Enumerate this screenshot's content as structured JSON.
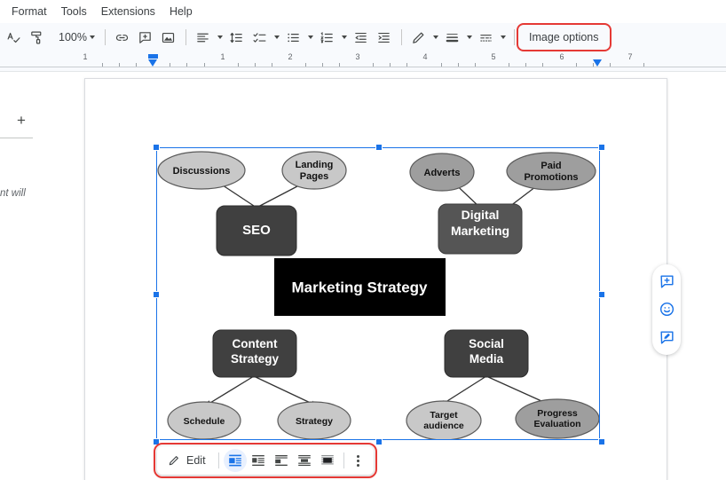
{
  "menubar": {
    "items": [
      {
        "label": "Format",
        "name": "menu-format"
      },
      {
        "label": "Tools",
        "name": "menu-tools"
      },
      {
        "label": "Extensions",
        "name": "menu-extensions"
      },
      {
        "label": "Help",
        "name": "menu-help"
      }
    ]
  },
  "toolbar": {
    "spelling_icon": "spellcheck-icon",
    "paint_format_icon": "paint-format-icon",
    "zoom_value": "100%",
    "link_icon": "insert-link-icon",
    "comment_icon": "add-comment-icon",
    "image_icon": "insert-image-icon",
    "align_icon": "text-align-left-icon",
    "line_spacing_icon": "line-spacing-icon",
    "checklist_icon": "checklist-icon",
    "bulleted_list_icon": "bulleted-list-icon",
    "numbered_list_icon": "numbered-list-icon",
    "decrease_indent_icon": "decrease-indent-icon",
    "increase_indent_icon": "increase-indent-icon",
    "pen_icon": "border-pen-icon",
    "border_weight_icon": "border-weight-icon",
    "border_dash_icon": "border-dash-icon",
    "image_options_label": "Image options",
    "image_options_highlight_color": "#e53935"
  },
  "ruler": {
    "numbers": [
      "1",
      "1",
      "2",
      "3",
      "4",
      "5",
      "6",
      "7"
    ],
    "left_indent_marker": "left-indent-marker",
    "right_indent_marker": "right-indent-marker"
  },
  "gutter": {
    "add_icon": "+",
    "partial_text": "nt will"
  },
  "diagram": {
    "title": "Marketing Strategy",
    "accent_node_bg": "#000000",
    "box_node_bg": "#404040",
    "ellipse_node_bg": "#c8c8c8",
    "edge_color": "#333333",
    "center": {
      "label": "Marketing Strategy"
    },
    "branches": [
      {
        "label": "SEO",
        "children": [
          "Discussions",
          "Landing Pages"
        ]
      },
      {
        "label": "Digital Marketing",
        "children": [
          "Adverts",
          "Paid Promotions"
        ]
      },
      {
        "label": "Content Strategy",
        "children": [
          "Schedule",
          "Strategy"
        ]
      },
      {
        "label": "Social Media",
        "children": [
          "Target audience",
          "Progress Evaluation"
        ]
      }
    ],
    "nodes": {
      "discussions": "Discussions",
      "landing_pages_line1": "Landing",
      "landing_pages_line2": "Pages",
      "seo": "SEO",
      "adverts": "Adverts",
      "paid_line1": "Paid",
      "paid_line2": "Promotions",
      "digital_line1": "Digital",
      "digital_line2": "Marketing",
      "content_line1": "Content",
      "content_line2": "Strategy",
      "social_line1": "Social",
      "social_line2": "Media",
      "schedule": "Schedule",
      "strategy": "Strategy",
      "target_line1": "Target",
      "target_line2": "audience",
      "progress_line1": "Progress",
      "progress_line2": "Evaluation"
    }
  },
  "selection": {
    "accent_color": "#1a73e8",
    "handles": [
      "nw",
      "n",
      "ne",
      "w",
      "e",
      "sw",
      "s",
      "se"
    ]
  },
  "image_bubble": {
    "edit_label": "Edit",
    "edit_icon": "pencil-icon",
    "highlight_color": "#e53935",
    "wrap_options": [
      {
        "name": "wrap-inline-icon",
        "active": true
      },
      {
        "name": "wrap-text-icon",
        "active": false
      },
      {
        "name": "wrap-break-text-icon",
        "active": false
      },
      {
        "name": "wrap-behind-text-icon",
        "active": false
      },
      {
        "name": "wrap-in-front-of-text-icon",
        "active": false
      }
    ],
    "more_icon": "more-options-icon"
  },
  "side_actions": {
    "items": [
      {
        "name": "add-comment-icon"
      },
      {
        "name": "add-emoji-reaction-icon"
      },
      {
        "name": "suggest-edits-icon"
      }
    ],
    "color": "#1a73e8"
  }
}
